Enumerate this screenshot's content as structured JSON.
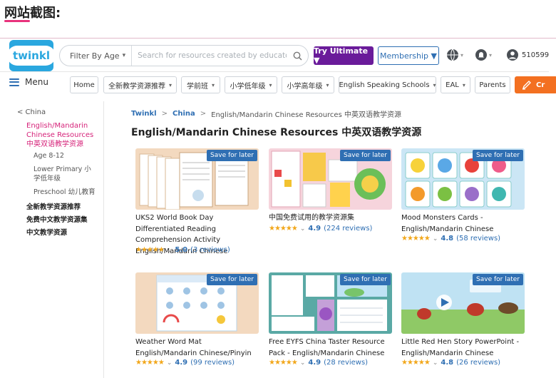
{
  "caption": "网站截图:",
  "logo": {
    "text": "twinkl"
  },
  "search": {
    "filter_label": "Filter By Age",
    "placeholder": "Search for resources created by educators"
  },
  "header": {
    "try_ultimate": "Try Ultimate ▼",
    "membership": "Membership ▼",
    "user_id": "510599"
  },
  "menu_label": "Menu",
  "nav": [
    {
      "label": "Home"
    },
    {
      "label": "全新教学资源推荐"
    },
    {
      "label": "学前班"
    },
    {
      "label": "小学低年级"
    },
    {
      "label": "小学高年级"
    },
    {
      "label": "English Speaking Schools"
    },
    {
      "label": "EAL"
    },
    {
      "label": "Parents"
    }
  ],
  "cta_label": "Cr",
  "sidebar": {
    "back": "< China",
    "active": "English/Mandarin Chinese Resources 中英双语教学资源",
    "sub": [
      "Age 8-12",
      "Lower Primary 小学低年级",
      "Preschool 幼儿教育"
    ],
    "main": [
      "全新教学资源推荐",
      "免费中文教学资源集",
      "中文教学资源"
    ]
  },
  "breadcrumb": {
    "items": [
      "Twinkl",
      "China"
    ],
    "current": "English/Mandarin Chinese Resources 中英双语教学资源",
    "sep": ">"
  },
  "page_title": "English/Mandarin Chinese Resources 中英双语教学资源",
  "save_label": "Save for later",
  "cards": [
    {
      "title": "UKS2 World Book Day Differentiated Reading Comprehension Activity English/Mandarin Chinese",
      "stars": "★★★★★",
      "score": "5.0",
      "reviews": "(3 reviews)"
    },
    {
      "title": "中国免费试用的教学资源集",
      "stars": "★★★★★",
      "score": "4.9",
      "reviews": "(224 reviews)"
    },
    {
      "title": "Mood Monsters Cards - English/Mandarin Chinese",
      "stars": "★★★★★",
      "score": "4.8",
      "reviews": "(58 reviews)"
    },
    {
      "title": "Weather Word Mat English/Mandarin Chinese/Pinyin",
      "stars": "★★★★★",
      "score": "4.9",
      "reviews": "(99 reviews)"
    },
    {
      "title": "Free EYFS China Taster Resource Pack - English/Mandarin Chinese",
      "stars": "★★★★★",
      "score": "4.9",
      "reviews": "(28 reviews)"
    },
    {
      "title": "Little Red Hen Story PowerPoint - English/Mandarin Chinese",
      "stars": "★★★★★",
      "score": "4.8",
      "reviews": "(26 reviews)"
    }
  ],
  "chev": "⌄",
  "colors": {
    "brand_blue": "#2aa7df",
    "link_blue": "#2f6fb3",
    "purple": "#6a1b9a",
    "orange": "#f37021",
    "pink": "#d6237a",
    "star": "#f2a71b"
  }
}
